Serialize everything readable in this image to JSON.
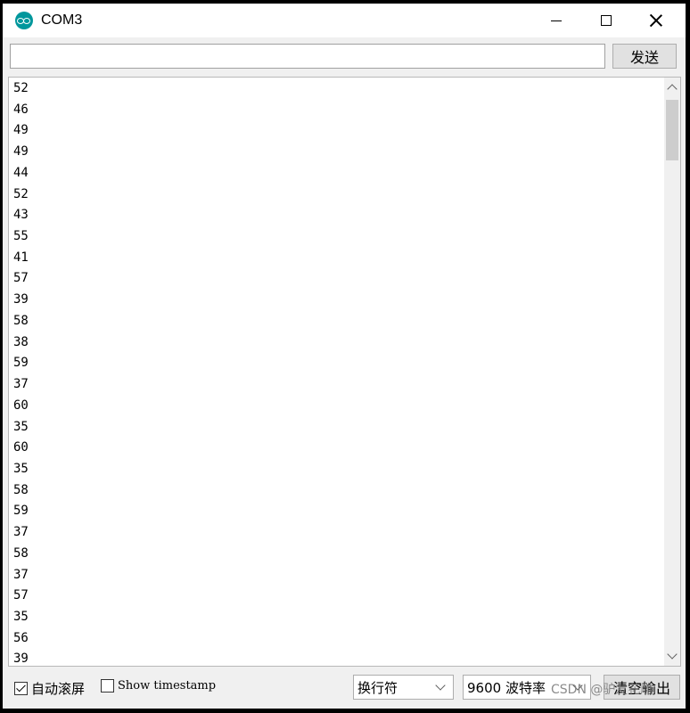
{
  "window": {
    "title": "COM3"
  },
  "input_row": {
    "input_value": "",
    "send_label": "发送"
  },
  "output": {
    "lines": [
      "52",
      "46",
      "49",
      "49",
      "44",
      "52",
      "43",
      "55",
      "41",
      "57",
      "39",
      "58",
      "38",
      "59",
      "37",
      "60",
      "35",
      "60",
      "35",
      "58",
      "59",
      "37",
      "58",
      "37",
      "57",
      "35",
      "56",
      "39"
    ]
  },
  "bottom_bar": {
    "autoscroll_label": "自动滚屏",
    "autoscroll_checked": true,
    "timestamp_label": "Show timestamp",
    "timestamp_checked": false,
    "line_ending_value": "换行符",
    "baud_value": "9600 波特率",
    "clear_label": "清空输出"
  },
  "watermark": "CSDN @驴友花雕",
  "colors": {
    "app_icon": "#00979c",
    "window_bg": "#f0f0f0",
    "output_bg": "#ffffff"
  }
}
